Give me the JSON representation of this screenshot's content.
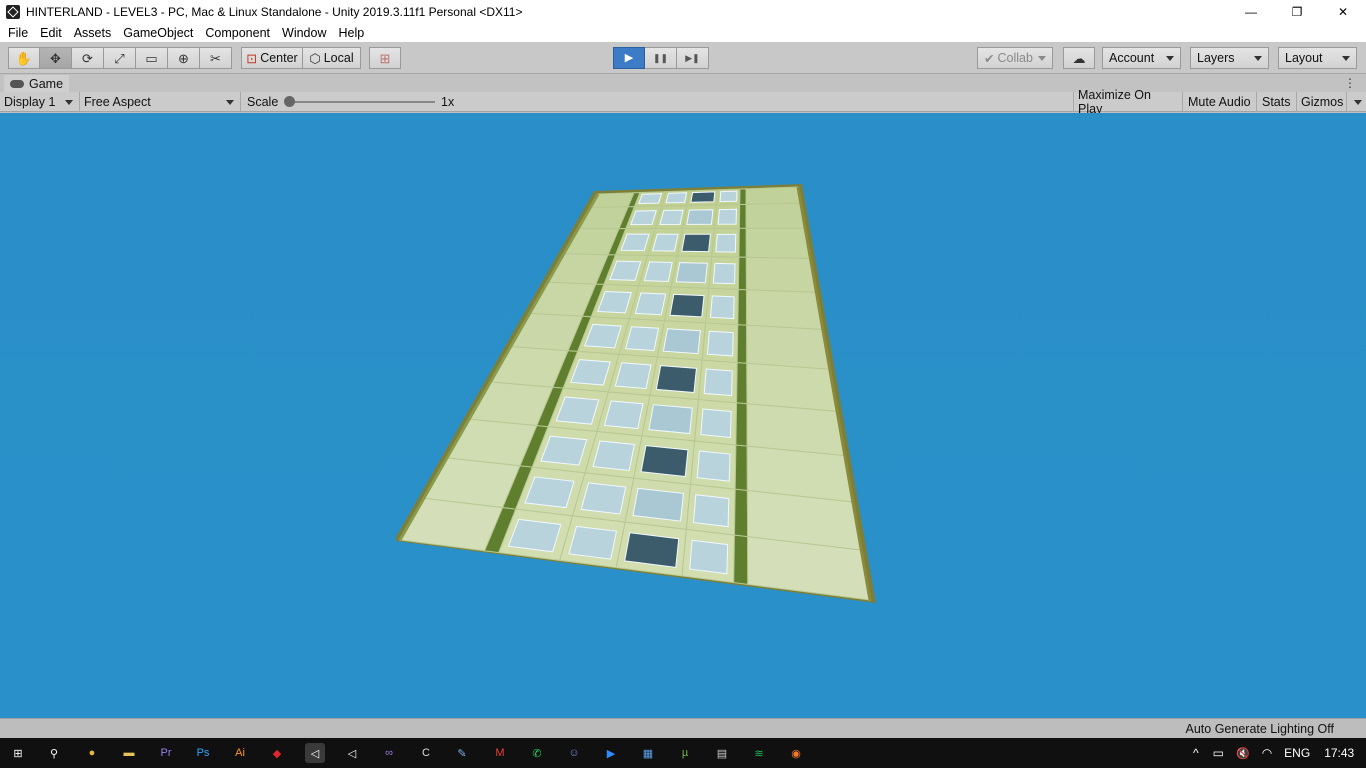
{
  "window": {
    "title": "HINTERLAND - LEVEL3 - PC, Mac & Linux Standalone - Unity 2019.3.11f1 Personal <DX11>",
    "controls": {
      "minimize": "—",
      "restore": "❐",
      "close": "✕"
    }
  },
  "menu": [
    "File",
    "Edit",
    "Assets",
    "GameObject",
    "Component",
    "Window",
    "Help"
  ],
  "toolbar": {
    "tools": [
      {
        "name": "hand-tool",
        "glyph": "✋"
      },
      {
        "name": "move-tool",
        "glyph": "✥"
      },
      {
        "name": "rotate-tool",
        "glyph": "⟳"
      },
      {
        "name": "scale-tool",
        "glyph": "⤢"
      },
      {
        "name": "rect-tool",
        "glyph": "▭"
      },
      {
        "name": "transform-tool",
        "glyph": "⊕"
      },
      {
        "name": "custom-tool",
        "glyph": "✂"
      }
    ],
    "pivot_label": "Center",
    "space_label": "Local",
    "play": {
      "play": "▶",
      "pause": "❚❚",
      "step": "▶❚"
    },
    "collab_label": "Collab",
    "account_label": "Account",
    "layers_label": "Layers",
    "layout_label": "Layout"
  },
  "game_tab": {
    "label": "Game",
    "menu_glyph": "⋮"
  },
  "game_toolbar": {
    "display": "Display 1",
    "aspect": "Free Aspect",
    "scale_label": "Scale",
    "scale_value": "1x",
    "scale_fraction": 0.0,
    "maximize": "Maximize On Play",
    "mute": "Mute Audio",
    "stats": "Stats",
    "gizmos": "Gizmos"
  },
  "status": {
    "lighting": "Auto Generate Lighting Off"
  },
  "colors": {
    "sky": "#2a90c9",
    "play_active": "#3d7bc7",
    "floor_light": "#cdd9a6",
    "floor_dark": "#5f7f2f"
  },
  "taskbar": {
    "apps": [
      {
        "name": "start-icon",
        "glyph": "⊞",
        "color": "#ffffff"
      },
      {
        "name": "search-icon",
        "glyph": "⚲",
        "color": "#ffffff"
      },
      {
        "name": "chrome-icon",
        "glyph": "●",
        "color": "#e8b83a"
      },
      {
        "name": "folder-icon",
        "glyph": "▬",
        "color": "#e8c35a"
      },
      {
        "name": "premiere-icon",
        "glyph": "Pr",
        "color": "#9a7cf4"
      },
      {
        "name": "photoshop-icon",
        "glyph": "Ps",
        "color": "#31a8ff"
      },
      {
        "name": "illustrator-icon",
        "glyph": "Ai",
        "color": "#ff9a00"
      },
      {
        "name": "ruby-icon",
        "glyph": "◆",
        "color": "#e3262e"
      },
      {
        "name": "unity-icon",
        "glyph": "◁",
        "color": "#ffffff"
      },
      {
        "name": "unity-hub-icon",
        "glyph": "◁",
        "color": "#ffffff"
      },
      {
        "name": "visual-studio-icon",
        "glyph": "∞",
        "color": "#a179dc"
      },
      {
        "name": "c-app-icon",
        "glyph": "C",
        "color": "#dddddd"
      },
      {
        "name": "paint-icon",
        "glyph": "✎",
        "color": "#7fb3e0"
      },
      {
        "name": "gmail-icon",
        "glyph": "M",
        "color": "#ea4335"
      },
      {
        "name": "whatsapp-icon",
        "glyph": "✆",
        "color": "#25d366"
      },
      {
        "name": "discord-icon",
        "glyph": "☺",
        "color": "#7289da"
      },
      {
        "name": "zoom-icon",
        "glyph": "▶",
        "color": "#2d8cff"
      },
      {
        "name": "calendar-icon",
        "glyph": "▦",
        "color": "#5aa0e8"
      },
      {
        "name": "utorrent-icon",
        "glyph": "µ",
        "color": "#76b83f"
      },
      {
        "name": "monitor-icon",
        "glyph": "▤",
        "color": "#cccccc"
      },
      {
        "name": "spotify-icon",
        "glyph": "≋",
        "color": "#1db954"
      },
      {
        "name": "blender-icon",
        "glyph": "◉",
        "color": "#f5792a"
      }
    ],
    "tray": {
      "chevron": "^",
      "battery": "▭",
      "volume": "🔇",
      "wifi": "◠",
      "lang": "ENG",
      "time": "17:43"
    }
  }
}
